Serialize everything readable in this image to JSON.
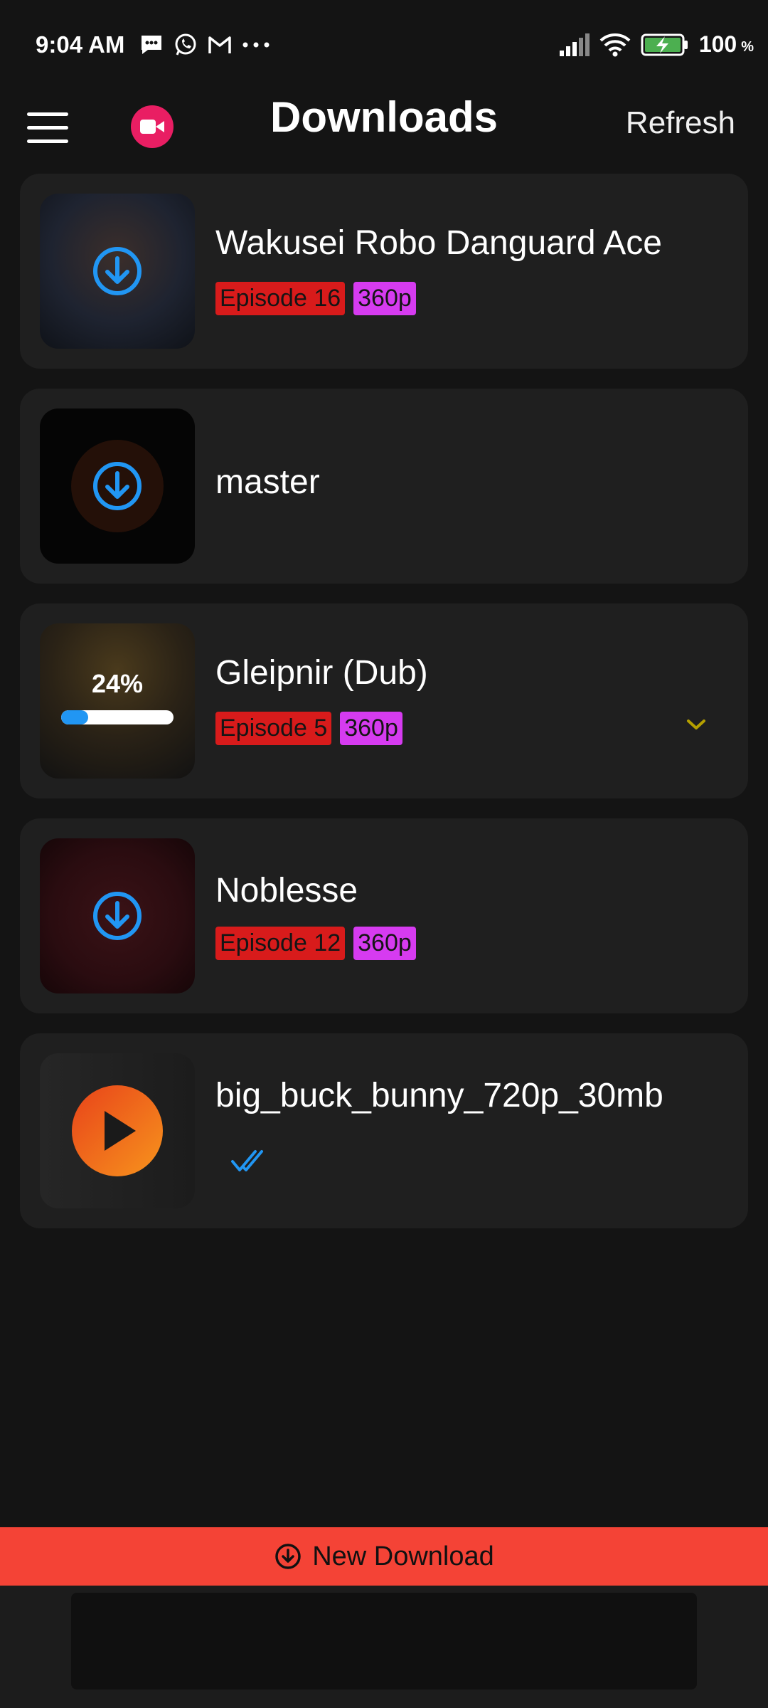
{
  "status_bar": {
    "time": "9:04 AM",
    "battery": "100",
    "battery_unit": "%",
    "icons": [
      "message-icon",
      "whatsapp-icon",
      "gmail-icon",
      "more-dots-icon",
      "signal-icon",
      "wifi-icon",
      "battery-charging-icon"
    ]
  },
  "header": {
    "title": "Downloads",
    "refresh_label": "Refresh"
  },
  "downloads": [
    {
      "title": "Wakusei Robo Danguard Ace",
      "episode": "Episode 16",
      "quality": "360p",
      "state": "download"
    },
    {
      "title": "master",
      "state": "download"
    },
    {
      "title": "Gleipnir (Dub)",
      "episode": "Episode 5",
      "quality": "360p",
      "state": "in-progress",
      "progress_text": "24%",
      "progress": 0.24
    },
    {
      "title": "Noblesse",
      "episode": "Episode 12",
      "quality": "360p",
      "state": "download"
    },
    {
      "title": "big_buck_bunny_720p_30mb",
      "state": "completed"
    }
  ],
  "footer": {
    "new_download_label": "New Download"
  },
  "colors": {
    "accent_blue": "#2196f3",
    "record_pink": "#e91e63",
    "episode_red": "#d81b1b",
    "quality_magenta": "#d63bf0",
    "new_download_red": "#f44336"
  }
}
